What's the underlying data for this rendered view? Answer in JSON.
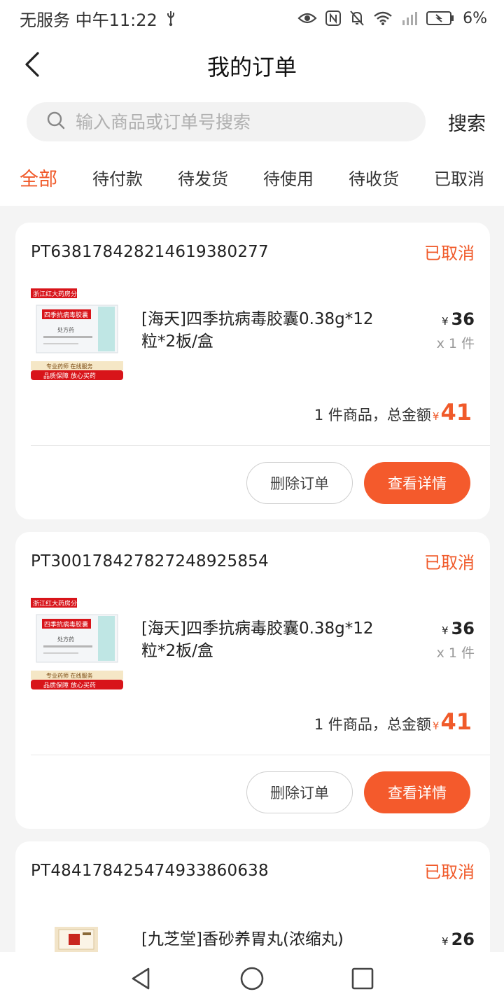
{
  "status_bar": {
    "left_text": "无服务 中午11:22",
    "battery": "6%"
  },
  "header": {
    "title": "我的订单"
  },
  "search": {
    "placeholder": "输入商品或订单号搜索",
    "button_label": "搜索"
  },
  "tabs": [
    {
      "label": "全部",
      "active": true
    },
    {
      "label": "待付款"
    },
    {
      "label": "待发货"
    },
    {
      "label": "待使用"
    },
    {
      "label": "待收货"
    },
    {
      "label": "已取消"
    }
  ],
  "orders": [
    {
      "order_no": "PT638178428214619380277",
      "status": "已取消",
      "product_name": "[海天]四季抗病毒胶囊0.38g*12粒*2板/盒",
      "price_symbol": "¥",
      "price": "36",
      "quantity": "x 1 件",
      "total_label": "1 件商品，总金额",
      "total_symbol": "¥",
      "total_amount": "41",
      "delete_label": "删除订单",
      "detail_label": "查看详情",
      "image_banner_top": "浙江红大药房分店",
      "image_box_title": "四季抗病毒胶囊",
      "image_rx": "处方药",
      "image_strip_1": "专业药师 在线服务",
      "image_strip_2": "品质保障 放心买药"
    },
    {
      "order_no": "PT300178427827248925854",
      "status": "已取消",
      "product_name": "[海天]四季抗病毒胶囊0.38g*12粒*2板/盒",
      "price_symbol": "¥",
      "price": "36",
      "quantity": "x 1 件",
      "total_label": "1 件商品，总金额",
      "total_symbol": "¥",
      "total_amount": "41",
      "delete_label": "删除订单",
      "detail_label": "查看详情",
      "image_banner_top": "浙江红大药房分店",
      "image_box_title": "四季抗病毒胶囊",
      "image_rx": "处方药",
      "image_strip_1": "专业药师 在线服务",
      "image_strip_2": "品质保障 放心买药"
    },
    {
      "order_no": "PT484178425474933860638",
      "status": "已取消",
      "product_name": "[九芝堂]香砂养胃丸(浓缩丸)",
      "price_symbol": "¥",
      "price": "26"
    }
  ],
  "colors": {
    "accent": "#f05a2a",
    "button_primary": "#f45a2c",
    "page_bg": "#f4f4f4"
  },
  "icons": [
    "back-arrow-icon",
    "search-icon",
    "usb-icon",
    "eye-icon",
    "nfc-icon",
    "mute-icon",
    "wifi-icon",
    "signal-icon",
    "battery-icon",
    "nav-back-icon",
    "nav-home-icon",
    "nav-recent-icon"
  ]
}
